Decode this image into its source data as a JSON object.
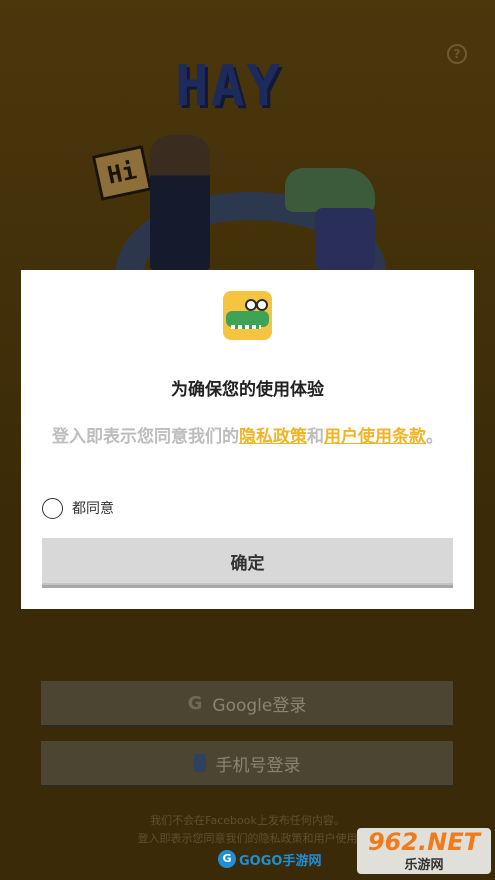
{
  "background": {
    "logo_text": "HAY",
    "hi_bubble_text": "Hi"
  },
  "help_icon": "?",
  "dialog": {
    "title": "为确保您的使用体验",
    "consent_prefix": "登入即表示您同意我们的",
    "privacy_link": "隐私政策",
    "conjunction": "和",
    "terms_link": "用户使用条款",
    "suffix": "。",
    "agree_label": "都同意",
    "confirm_label": "确定"
  },
  "login": {
    "google_icon": "G",
    "google_label": "Google登录",
    "phone_label": "手机号登录"
  },
  "footer": {
    "line1": "我们不会在Facebook上发布任何内容。",
    "line2": "登入即表示您同意我们的隐私政策和用户使用"
  },
  "watermark": {
    "left_text": "GOGO手游网",
    "right_top": "962.NET",
    "right_bottom": "乐游网"
  },
  "colors": {
    "accent_link": "#f0b429",
    "dialog_bg": "#ffffff",
    "backdrop": "#3d2d0b"
  }
}
